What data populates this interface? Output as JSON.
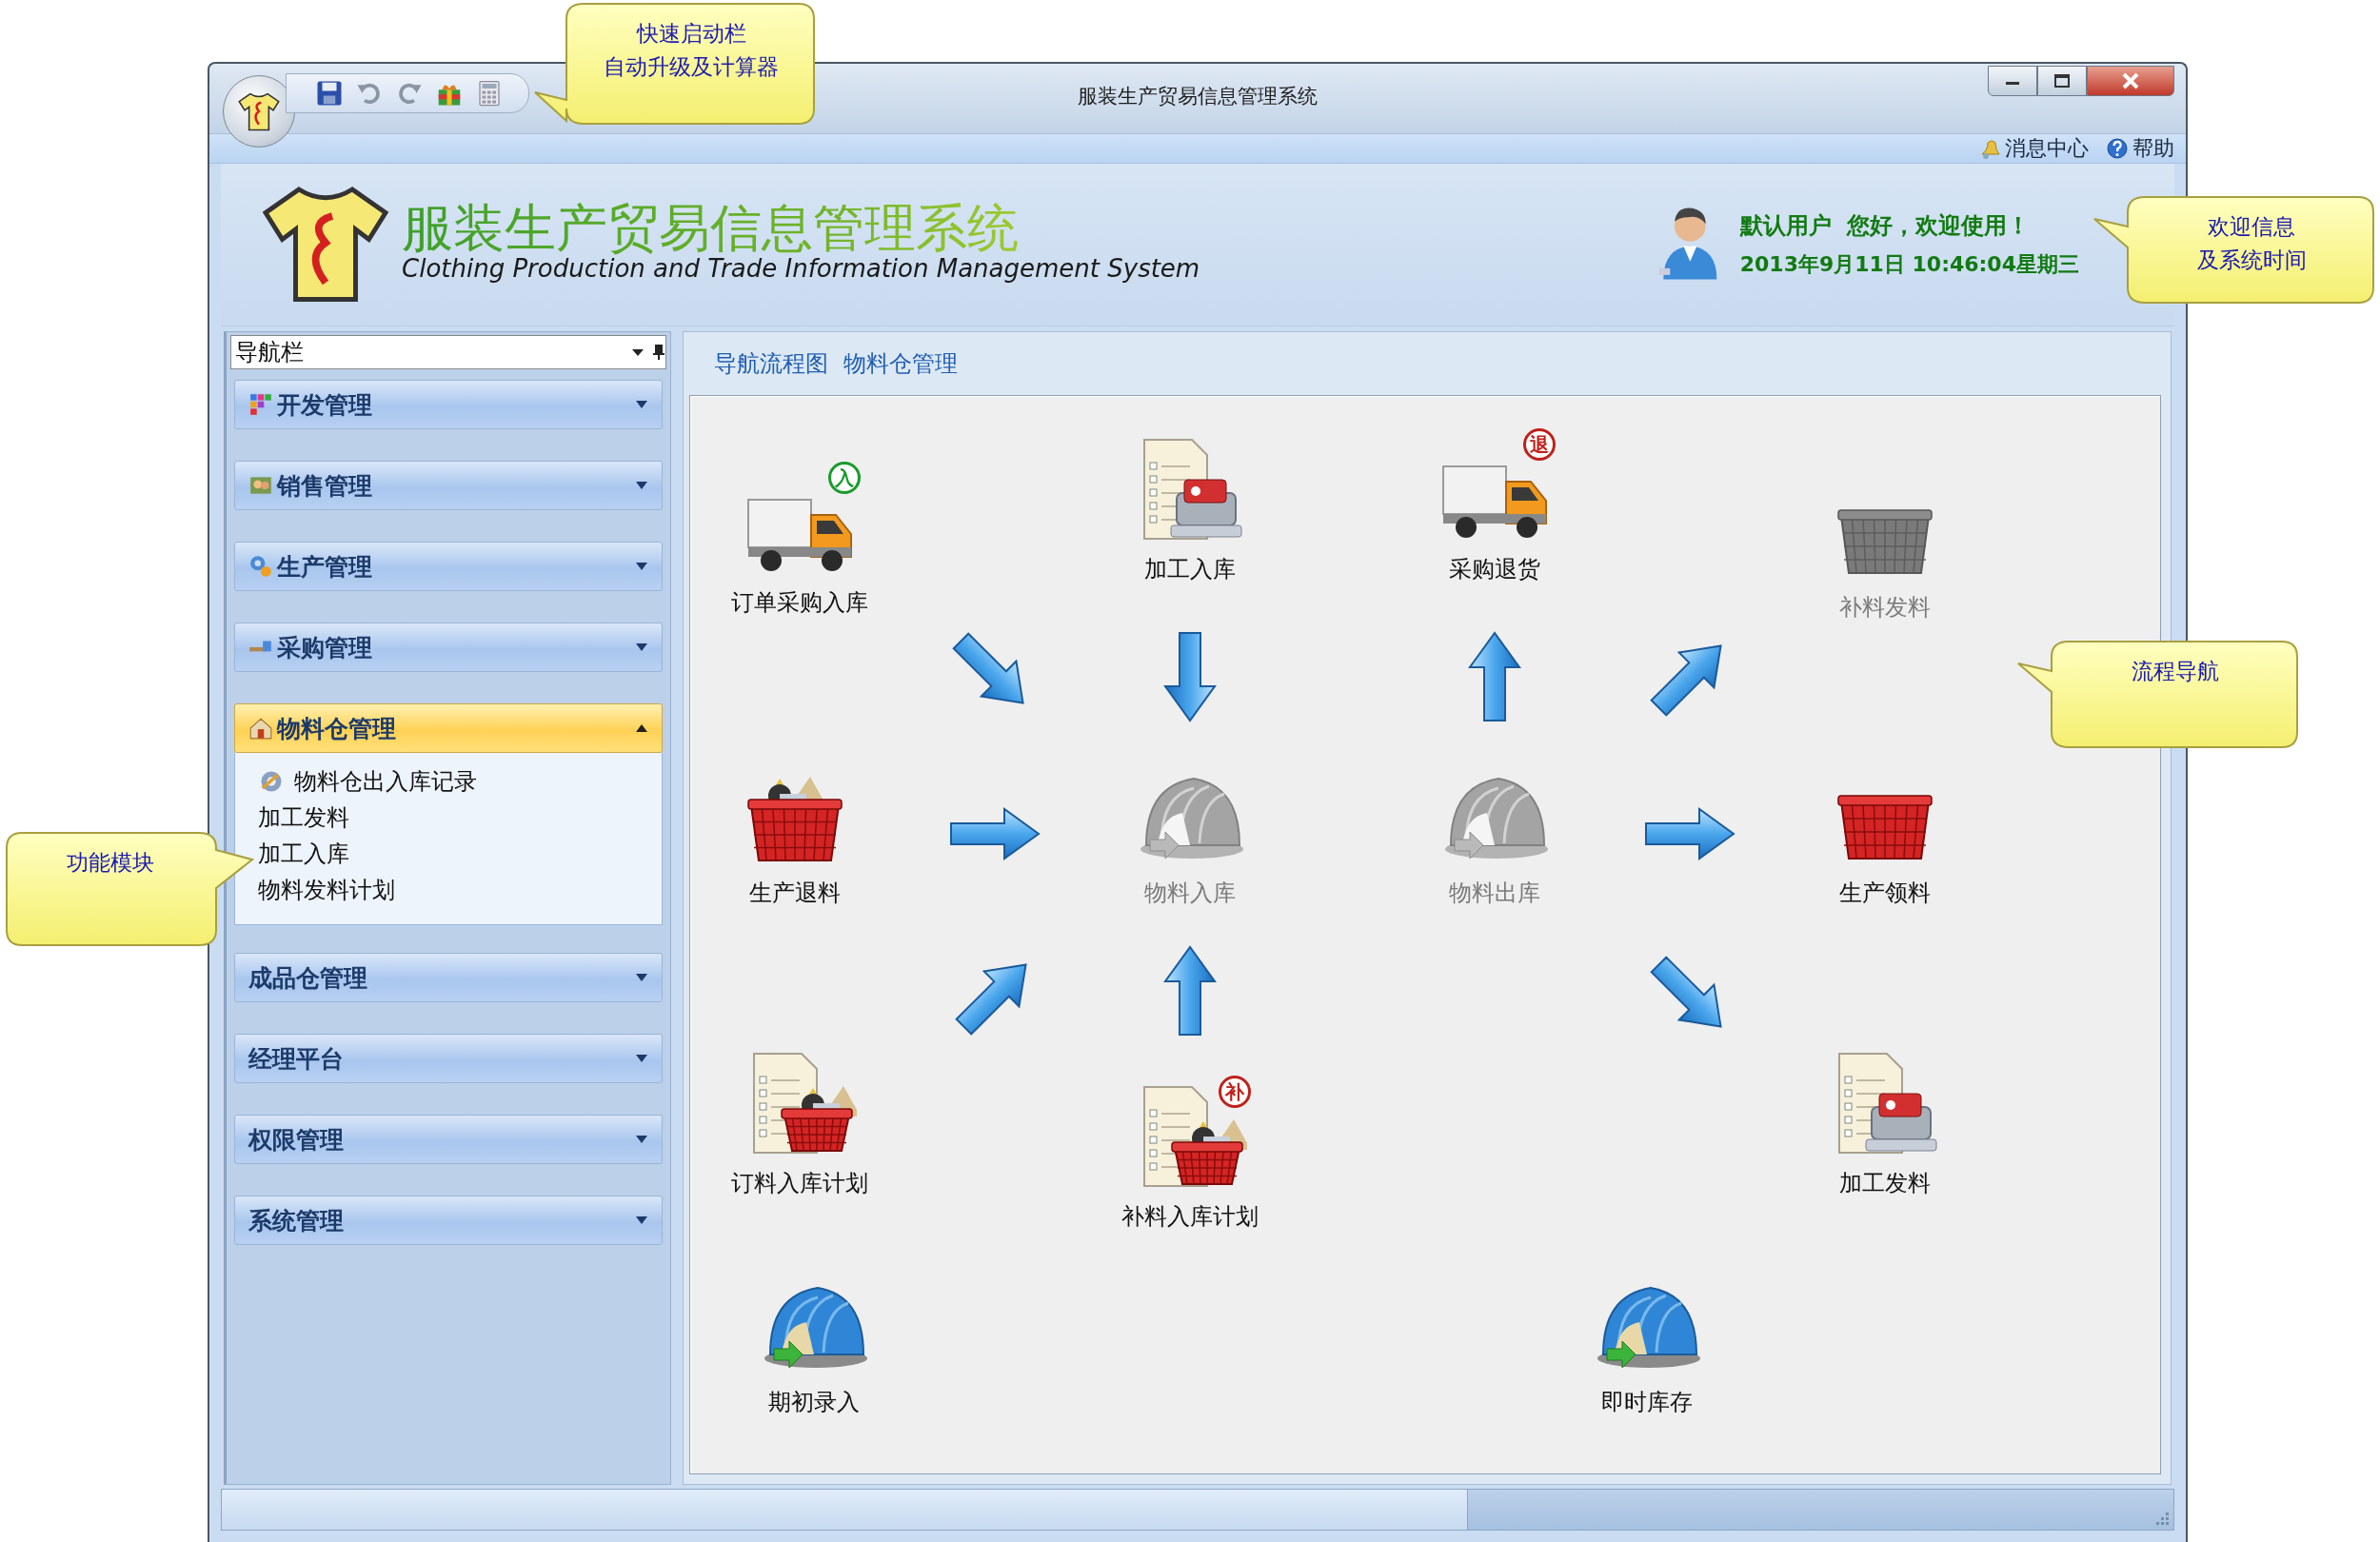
{
  "window": {
    "title": "服装生产贸易信息管理系统"
  },
  "menu_bar": {
    "items": [
      {
        "label": "消息中心"
      },
      {
        "label": "帮助"
      }
    ]
  },
  "header": {
    "title": "服装生产贸易信息管理系统",
    "subtitle": "Clothing Production and Trade Information Management System",
    "greeting": "默认用户  您好，欢迎使用！",
    "datetime": "2013年9月11日 10:46:04星期三"
  },
  "nav": {
    "title": "导航栏",
    "groups": [
      {
        "label": "开发管理",
        "expanded": false
      },
      {
        "label": "销售管理",
        "expanded": false
      },
      {
        "label": "生产管理",
        "expanded": false
      },
      {
        "label": "采购管理",
        "expanded": false
      },
      {
        "label": "物料仓管理",
        "expanded": true,
        "items": [
          "物料仓出入库记录",
          "加工发料",
          "加工入库",
          "物料发料计划"
        ]
      },
      {
        "label": "成品仓管理",
        "expanded": false
      },
      {
        "label": "经理平台",
        "expanded": false
      },
      {
        "label": "权限管理",
        "expanded": false
      },
      {
        "label": "系统管理",
        "expanded": false
      }
    ]
  },
  "breadcrumb": [
    "导航流程图",
    "物料仓管理"
  ],
  "flow": {
    "nodes": [
      {
        "label": "订单采购入库",
        "kind": "truck",
        "disabled": false,
        "badge": {
          "text": "入",
          "color": "#1a9a2a"
        }
      },
      {
        "label": "加工入库",
        "kind": "workorder",
        "disabled": false
      },
      {
        "label": "采购退货",
        "kind": "truck",
        "disabled": false,
        "badge": {
          "text": "退",
          "color": "#c0201a"
        }
      },
      {
        "label": "补料发料",
        "kind": "basket",
        "disabled": true
      },
      {
        "label": "生产退料",
        "kind": "supplies",
        "disabled": false
      },
      {
        "label": "物料入库",
        "kind": "hangar",
        "disabled": true
      },
      {
        "label": "物料出库",
        "kind": "hangar",
        "disabled": true
      },
      {
        "label": "生产领料",
        "kind": "basket",
        "disabled": false
      },
      {
        "label": "订料入库计划",
        "kind": "plan",
        "disabled": false
      },
      {
        "label": "补料入库计划",
        "kind": "plan",
        "disabled": false,
        "badge": {
          "text": "补",
          "color": "#c0201a"
        }
      },
      {
        "label": "加工发料",
        "kind": "workorder",
        "disabled": false
      },
      {
        "label": "期初录入",
        "kind": "hangar",
        "disabled": false
      },
      {
        "label": "即时库存",
        "kind": "hangar",
        "disabled": false
      }
    ]
  },
  "callouts": [
    {
      "lines": [
        "快速启动栏",
        "自动升级及计算器"
      ]
    },
    {
      "lines": [
        "欢迎信息",
        "及系统时间"
      ]
    },
    {
      "lines": [
        "流程导航"
      ]
    },
    {
      "lines": [
        "功能模块"
      ]
    }
  ]
}
